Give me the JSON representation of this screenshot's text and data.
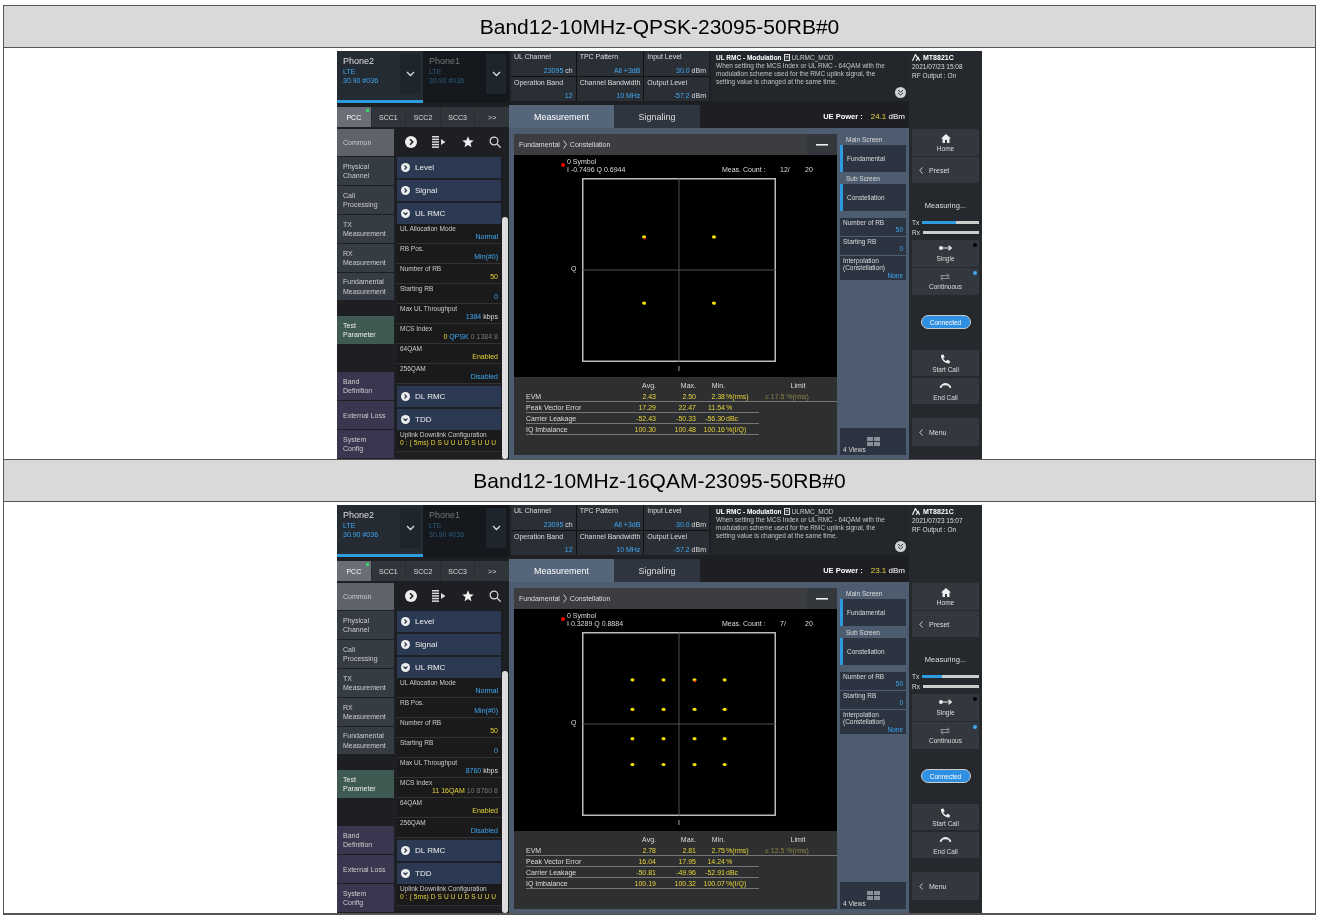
{
  "sections": [
    {
      "heading": "Band12-10MHz-QPSK-23095-50RB#0",
      "screen": {
        "phones": [
          {
            "name": "Phone2",
            "system": "LTE",
            "info": "30.90 #036",
            "selected": true
          },
          {
            "name": "Phone1",
            "system": "LTE",
            "info": "30.90 #036",
            "selected": false
          }
        ],
        "cc_tabs": [
          {
            "label": "PCC",
            "selected": true,
            "active_dot": true
          },
          {
            "label": "SCC1",
            "selected": false,
            "active_dot": false
          },
          {
            "label": "SCC2",
            "selected": false,
            "active_dot": false
          },
          {
            "label": "SCC3",
            "selected": false,
            "active_dot": false
          },
          {
            "label": ">>",
            "selected": false,
            "active_dot": false
          }
        ],
        "nav": [
          {
            "label": "Common",
            "kind": "common",
            "selected": false
          },
          {
            "label": "Physical Channel",
            "kind": "meas",
            "selected": false
          },
          {
            "label": "Call Processing",
            "kind": "meas",
            "selected": false
          },
          {
            "label": "TX Measurement",
            "kind": "meas",
            "selected": false
          },
          {
            "label": "RX Measurement",
            "kind": "meas",
            "selected": false
          },
          {
            "label": "Fundamental Measurement",
            "kind": "meas",
            "selected": false
          },
          {
            "label": "Test Parameter",
            "kind": "test",
            "selected": true
          },
          {
            "label": "Band Definition",
            "kind": "setting",
            "selected": false
          },
          {
            "label": "External Loss",
            "kind": "setting",
            "selected": false
          },
          {
            "label": "System Config",
            "kind": "setting",
            "selected": false
          }
        ],
        "groups": [
          {
            "label": "Level",
            "expanded": false
          },
          {
            "label": "Signal",
            "expanded": false
          },
          {
            "label": "UL RMC",
            "expanded": true,
            "children": [
              {
                "label": "UL Allocation Mode",
                "value": [
                  {
                    "text": "Normal",
                    "kind": "value"
                  }
                ]
              },
              {
                "label": "RB Pos.",
                "value": [
                  {
                    "text": "Min(#0)",
                    "kind": "value"
                  }
                ]
              },
              {
                "label": "Number of RB",
                "value": [
                  {
                    "text": "50",
                    "kind": "edited"
                  }
                ]
              },
              {
                "label": "Starting RB",
                "value": [
                  {
                    "text": "0",
                    "kind": "value"
                  }
                ]
              },
              {
                "label": "Max UL Throughput",
                "value": [
                  {
                    "text": "1384",
                    "kind": "value"
                  },
                  {
                    "text": "kbps",
                    "kind": "plain"
                  }
                ]
              },
              {
                "label": "MCS Index",
                "value": [
                  {
                    "text": "0",
                    "kind": "edited"
                  },
                  {
                    "text": "QPSK",
                    "kind": "value"
                  },
                  {
                    "text": "0",
                    "kind": "info"
                  },
                  {
                    "text": "1384",
                    "kind": "info"
                  },
                  {
                    "text": "8",
                    "kind": "info"
                  }
                ]
              },
              {
                "label": "64QAM",
                "value": [
                  {
                    "text": "Enabled",
                    "kind": "edited"
                  }
                ]
              },
              {
                "label": "256QAM",
                "value": [
                  {
                    "text": "Disabled",
                    "kind": "value"
                  }
                ]
              }
            ]
          },
          {
            "label": "DL RMC",
            "expanded": false
          },
          {
            "label": "TDD",
            "expanded": true,
            "children": [
              {
                "label": "Uplink Downlink Configuration",
                "value": [
                  {
                    "text": "0 : ( 5ms) D S U U U D S U U U",
                    "kind": "edited"
                  }
                ]
              }
            ]
          }
        ],
        "params": [
          {
            "label": "UL Channel",
            "value": "23095",
            "unit": "ch"
          },
          {
            "label": "TPC Pattern",
            "value": "All +3dB"
          },
          {
            "label": "Input Level",
            "value": "30.0",
            "unit": "dBm"
          },
          {
            "label": "Operation Band",
            "value": "12"
          },
          {
            "label": "Channel Bandwidth",
            "value": "10 MHz"
          },
          {
            "label": "Output Level",
            "value": "-57.2",
            "unit": "dBm"
          }
        ],
        "help": {
          "title": "UL RMC - Modulation",
          "code": "ULRMC_MOD",
          "text": "When setting the MCS Index or UL RMC - 64QAM with the modulation scheme used for the RMC uplink signal, the setting value is changed at the same time."
        },
        "tabs": [
          {
            "label": "Measurement",
            "selected": true
          },
          {
            "label": "Signaling",
            "selected": false
          }
        ],
        "ue_power": {
          "label": "UE Power :",
          "value": "24.1",
          "unit": "dBm"
        },
        "breadcrumb": [
          "Fundamental",
          "Constellation"
        ],
        "plot": {
          "kind": "qpsk",
          "marker_label": "0 Symbol",
          "marker_value": "I -0.7496 Q 0.6944",
          "count_label": "Meas. Count :",
          "count": "12/",
          "count_total": "20",
          "y_axis": "Q",
          "x_axis": "I"
        },
        "results": {
          "columns": [
            "Avg.",
            "Max.",
            "Min.",
            "Limit"
          ],
          "rows": [
            {
              "label": "EVM",
              "avg": "2.43",
              "max": "2.50",
              "min": "2.38",
              "unit": "%(rms)",
              "limit": "≤ 17.5 %(rms)"
            },
            {
              "label": "Peak Vector Error",
              "avg": "17.29",
              "max": "22.47",
              "min": "11.54",
              "unit": "%"
            },
            {
              "label": "Carrier Leakage",
              "avg": "-52.43",
              "max": "-50.33",
              "min": "-56.30",
              "unit": "dBc"
            },
            {
              "label": "IQ Imbalance",
              "avg": "100.30",
              "max": "100.48",
              "min": "100.16",
              "unit": "%(I/Q)"
            }
          ]
        },
        "settings": {
          "main_label": "Main Screen",
          "main": "Fundamental",
          "sub_label": "Sub Screen",
          "sub": "Constellation",
          "params": [
            {
              "label": "Number of RB",
              "value": "50"
            },
            {
              "label": "Starting RB",
              "value": "0"
            },
            {
              "label": "Interpolation (Constellation)",
              "value": "None"
            }
          ],
          "views": "4 Views"
        },
        "sidebar": {
          "model": "MT8821C",
          "datetime": "2021/07/23 15:08",
          "rf_output": "RF Output : On",
          "home": "Home",
          "preset": "Preset",
          "status": "Measuring...",
          "meters": [
            {
              "label": "Tx",
              "level": 0.6
            },
            {
              "label": "Rx",
              "level": 0
            }
          ],
          "modes": [
            {
              "label": "Single",
              "kind": "single",
              "selected": false
            },
            {
              "label": "Continuous",
              "kind": "continuous",
              "selected": true
            }
          ],
          "connection": "Connected",
          "calls": [
            {
              "label": "Start Call",
              "kind": "start"
            },
            {
              "label": "End Call",
              "kind": "end"
            }
          ],
          "menu": "Menu"
        }
      }
    },
    {
      "heading": "Band12-10MHz-16QAM-23095-50RB#0",
      "screen": {
        "phones": [
          {
            "name": "Phone2",
            "system": "LTE",
            "info": "30.90 #036",
            "selected": true
          },
          {
            "name": "Phone1",
            "system": "LTE",
            "info": "30.90 #036",
            "selected": false
          }
        ],
        "cc_tabs": [
          {
            "label": "PCC",
            "selected": true,
            "active_dot": true
          },
          {
            "label": "SCC1",
            "selected": false,
            "active_dot": false
          },
          {
            "label": "SCC2",
            "selected": false,
            "active_dot": false
          },
          {
            "label": "SCC3",
            "selected": false,
            "active_dot": false
          },
          {
            "label": ">>",
            "selected": false,
            "active_dot": false
          }
        ],
        "nav": [
          {
            "label": "Common",
            "kind": "common",
            "selected": false
          },
          {
            "label": "Physical Channel",
            "kind": "meas",
            "selected": false
          },
          {
            "label": "Call Processing",
            "kind": "meas",
            "selected": false
          },
          {
            "label": "TX Measurement",
            "kind": "meas",
            "selected": false
          },
          {
            "label": "RX Measurement",
            "kind": "meas",
            "selected": false
          },
          {
            "label": "Fundamental Measurement",
            "kind": "meas",
            "selected": false
          },
          {
            "label": "Test Parameter",
            "kind": "test",
            "selected": true
          },
          {
            "label": "Band Definition",
            "kind": "setting",
            "selected": false
          },
          {
            "label": "External Loss",
            "kind": "setting",
            "selected": false
          },
          {
            "label": "System Config",
            "kind": "setting",
            "selected": false
          }
        ],
        "groups": [
          {
            "label": "Level",
            "expanded": false
          },
          {
            "label": "Signal",
            "expanded": false
          },
          {
            "label": "UL RMC",
            "expanded": true,
            "children": [
              {
                "label": "UL Allocation Mode",
                "value": [
                  {
                    "text": "Normal",
                    "kind": "value"
                  }
                ]
              },
              {
                "label": "RB Pos.",
                "value": [
                  {
                    "text": "Min(#0)",
                    "kind": "value"
                  }
                ]
              },
              {
                "label": "Number of RB",
                "value": [
                  {
                    "text": "50",
                    "kind": "edited"
                  }
                ]
              },
              {
                "label": "Starting RB",
                "value": [
                  {
                    "text": "0",
                    "kind": "value"
                  }
                ]
              },
              {
                "label": "Max UL Throughput",
                "value": [
                  {
                    "text": "8760",
                    "kind": "value"
                  },
                  {
                    "text": "kbps",
                    "kind": "plain"
                  }
                ]
              },
              {
                "label": "MCS Index",
                "value": [
                  {
                    "text": "11",
                    "kind": "edited"
                  },
                  {
                    "text": "16QAM",
                    "kind": "edited"
                  },
                  {
                    "text": "10",
                    "kind": "info"
                  },
                  {
                    "text": "8760",
                    "kind": "info"
                  },
                  {
                    "text": "8",
                    "kind": "info"
                  }
                ]
              },
              {
                "label": "64QAM",
                "value": [
                  {
                    "text": "Enabled",
                    "kind": "edited"
                  }
                ]
              },
              {
                "label": "256QAM",
                "value": [
                  {
                    "text": "Disabled",
                    "kind": "value"
                  }
                ]
              }
            ]
          },
          {
            "label": "DL RMC",
            "expanded": false
          },
          {
            "label": "TDD",
            "expanded": true,
            "children": [
              {
                "label": "Uplink Downlink Configuration",
                "value": [
                  {
                    "text": "0 : ( 5ms) D S U U U D S U U U",
                    "kind": "edited"
                  }
                ]
              }
            ]
          }
        ],
        "params": [
          {
            "label": "UL Channel",
            "value": "23095",
            "unit": "ch"
          },
          {
            "label": "TPC Pattern",
            "value": "All +3dB"
          },
          {
            "label": "Input Level",
            "value": "30.0",
            "unit": "dBm"
          },
          {
            "label": "Operation Band",
            "value": "12"
          },
          {
            "label": "Channel Bandwidth",
            "value": "10 MHz"
          },
          {
            "label": "Output Level",
            "value": "-57.2",
            "unit": "dBm"
          }
        ],
        "help": {
          "title": "UL RMC - Modulation",
          "code": "ULRMC_MOD",
          "text": "When setting the MCS Index or UL RMC - 64QAM with the modulation scheme used for the RMC uplink signal, the setting value is changed at the same time."
        },
        "tabs": [
          {
            "label": "Measurement",
            "selected": true
          },
          {
            "label": "Signaling",
            "selected": false
          }
        ],
        "ue_power": {
          "label": "UE Power :",
          "value": "23.1",
          "unit": "dBm"
        },
        "breadcrumb": [
          "Fundamental",
          "Constellation"
        ],
        "plot": {
          "kind": "qam16",
          "marker_label": "0 Symbol",
          "marker_value": "I 0.3289 Q 0.8884",
          "count_label": "Meas. Count :",
          "count": "7/",
          "count_total": "20",
          "y_axis": "Q",
          "x_axis": "I"
        },
        "results": {
          "columns": [
            "Avg.",
            "Max.",
            "Min.",
            "Limit"
          ],
          "rows": [
            {
              "label": "EVM",
              "avg": "2.78",
              "max": "2.81",
              "min": "2.75",
              "unit": "%(rms)",
              "limit": "≤ 12.5 %(rms)"
            },
            {
              "label": "Peak Vector Error",
              "avg": "16.04",
              "max": "17.95",
              "min": "14.24",
              "unit": "%"
            },
            {
              "label": "Carrier Leakage",
              "avg": "-50.81",
              "max": "-49.96",
              "min": "-52.91",
              "unit": "dBc"
            },
            {
              "label": "IQ Imbalance",
              "avg": "100.19",
              "max": "100.32",
              "min": "100.07",
              "unit": "%(I/Q)"
            }
          ]
        },
        "settings": {
          "main_label": "Main Screen",
          "main": "Fundamental",
          "sub_label": "Sub Screen",
          "sub": "Constellation",
          "params": [
            {
              "label": "Number of RB",
              "value": "50"
            },
            {
              "label": "Starting RB",
              "value": "0"
            },
            {
              "label": "Interpolation (Constellation)",
              "value": "None"
            }
          ],
          "views": "4 Views"
        },
        "sidebar": {
          "model": "MT8821C",
          "datetime": "2021/07/23 15:07",
          "rf_output": "RF Output : On",
          "home": "Home",
          "preset": "Preset",
          "status": "Measuring...",
          "meters": [
            {
              "label": "Tx",
              "level": 0.35
            },
            {
              "label": "Rx",
              "level": 0
            }
          ],
          "modes": [
            {
              "label": "Single",
              "kind": "single",
              "selected": false
            },
            {
              "label": "Continuous",
              "kind": "continuous",
              "selected": true
            }
          ],
          "connection": "Connected",
          "calls": [
            {
              "label": "Start Call",
              "kind": "start"
            },
            {
              "label": "End Call",
              "kind": "end"
            }
          ],
          "menu": "Menu"
        }
      }
    }
  ]
}
